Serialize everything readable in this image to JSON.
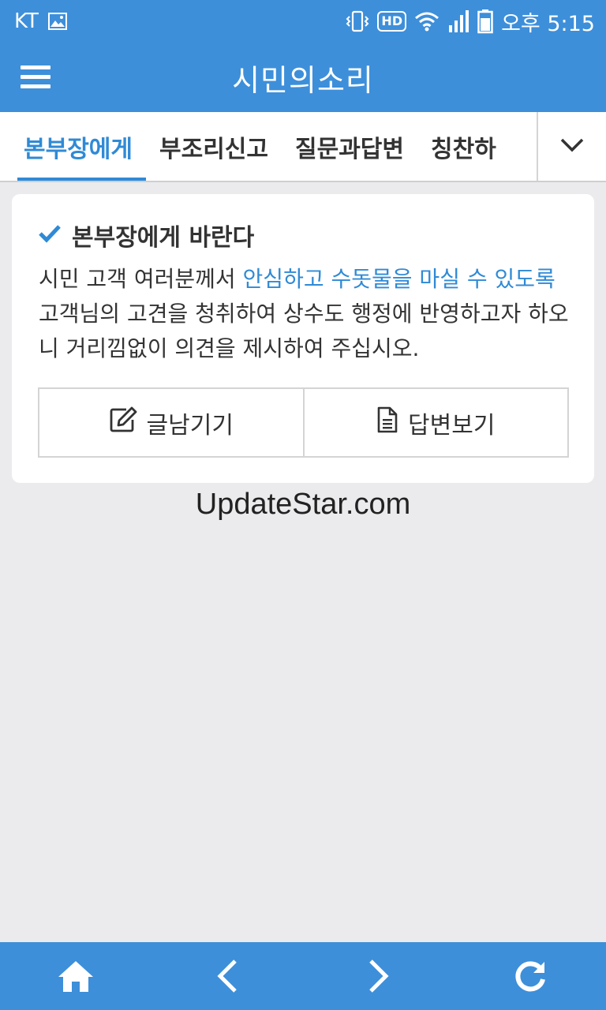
{
  "status_bar": {
    "carrier": "KT",
    "hd_label": "HD",
    "time": "오후 5:15"
  },
  "app": {
    "title": "시민의소리"
  },
  "tabs": [
    {
      "label": "본부장에게",
      "active": true
    },
    {
      "label": "부조리신고",
      "active": false
    },
    {
      "label": "질문과답변",
      "active": false
    },
    {
      "label": "칭찬하",
      "active": false
    }
  ],
  "card": {
    "title": "본부장에게 바란다",
    "text_before": "시민 고객 여러분께서 ",
    "text_highlight": "안심하고 수돗물을 마실 수 있도록",
    "text_after": " 고객님의 고견을 청취하여 상수도 행정에 반영하고자 하오니 거리낌없이 의견을 제시하여 주십시오.",
    "write_button": "글남기기",
    "view_button": "답변보기"
  },
  "watermark": "UpdateStar.com",
  "colors": {
    "primary": "#3d8fda",
    "accent": "#2f8ad6",
    "background": "#ebeaec"
  },
  "icons": {
    "menu": "hamburger-icon",
    "more": "chevron-down-icon",
    "check": "check-icon",
    "write": "edit-icon",
    "view": "document-icon",
    "home": "home-icon",
    "back": "chevron-left-icon",
    "forward": "chevron-right-icon",
    "refresh": "refresh-icon"
  }
}
